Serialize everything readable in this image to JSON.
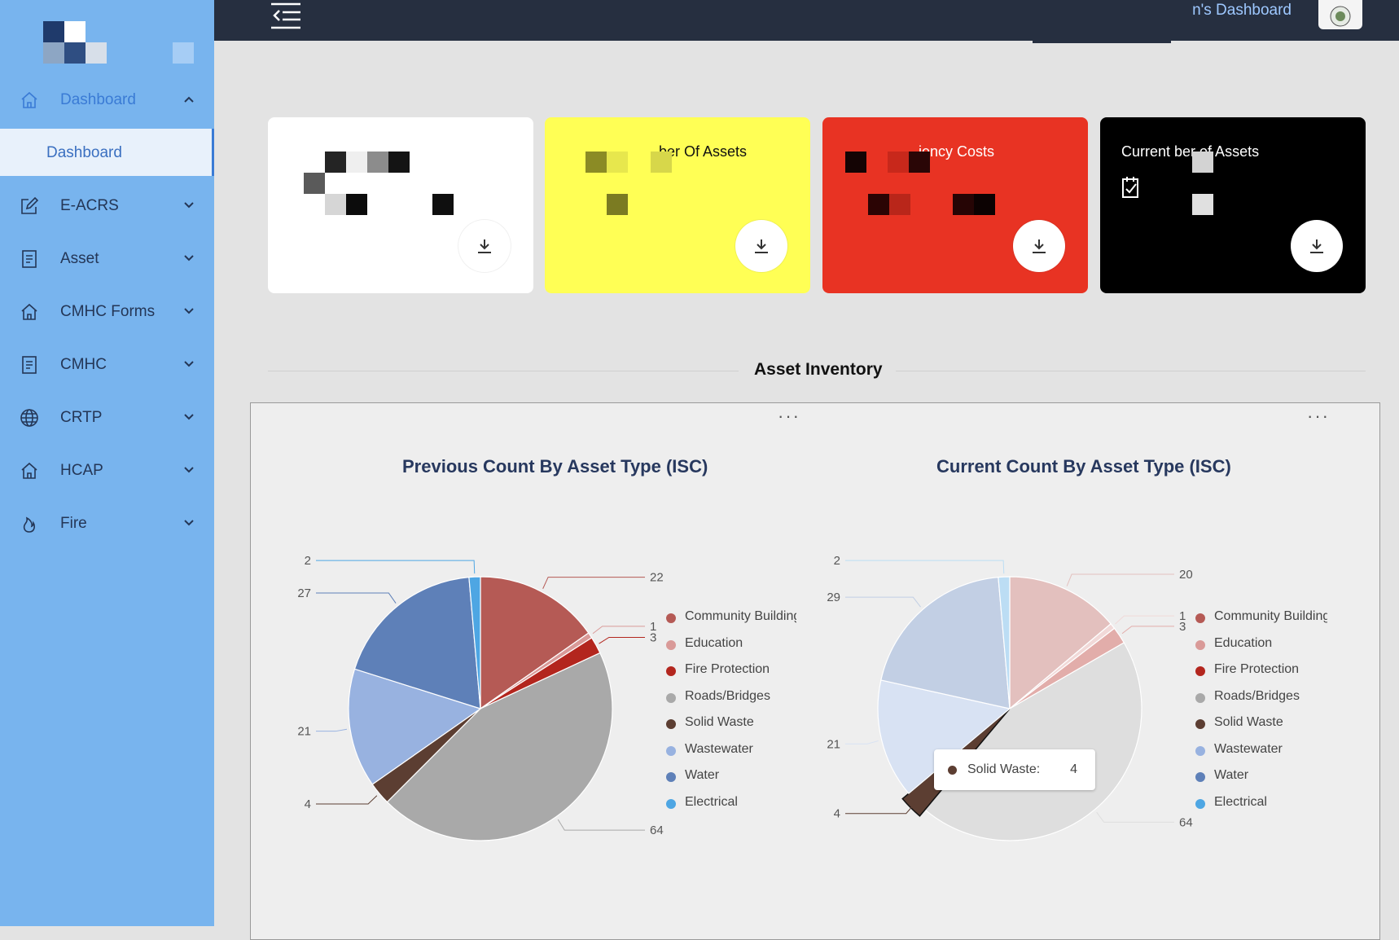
{
  "topbar": {
    "title": "n's Dashboard"
  },
  "sidebar": {
    "items": [
      {
        "label": "Dashboard",
        "icon": "home-icon",
        "expanded": true
      },
      {
        "label": "E-ACRS",
        "icon": "edit-icon"
      },
      {
        "label": "Asset",
        "icon": "receipt-icon"
      },
      {
        "label": "CMHC Forms",
        "icon": "home-icon"
      },
      {
        "label": "CMHC",
        "icon": "receipt-icon"
      },
      {
        "label": "CRTP",
        "icon": "globe-icon"
      },
      {
        "label": "HCAP",
        "icon": "home-icon"
      },
      {
        "label": "Fire",
        "icon": "flame-icon"
      }
    ],
    "sub_item": "Dashboard"
  },
  "cards": [
    {
      "title": "",
      "bg": "#ffffff",
      "fg": "#111111"
    },
    {
      "title": "ber Of Assets",
      "bg": "#ffff55",
      "fg": "#111111"
    },
    {
      "title": "iency Costs",
      "bg": "#e83323",
      "fg": "#ffffff"
    },
    {
      "title": "Current  ber of Assets",
      "bg": "#000000",
      "fg": "#ffffff"
    }
  ],
  "section": {
    "title": "Asset Inventory"
  },
  "colors": {
    "Community Building": "#b55a55",
    "Education": "#d99a98",
    "Fire Protection": "#b3261e",
    "Roads/Bridges": "#a9a9a9",
    "Solid Waste": "#5c3e32",
    "Wastewater": "#98b2e0",
    "Water": "#5e80b8",
    "Electrical": "#4ea6e3"
  },
  "chart_data": [
    {
      "type": "pie",
      "title": "Previous Count By Asset Type (ISC)",
      "categories": [
        "Community Building",
        "Education",
        "Fire Protection",
        "Roads/Bridges",
        "Solid Waste",
        "Wastewater",
        "Water",
        "Electrical"
      ],
      "values": [
        22,
        1,
        3,
        64,
        4,
        21,
        27,
        2
      ],
      "legend": [
        "Community Building",
        "Education",
        "Fire Protection",
        "Roads/Bridges",
        "Solid Waste",
        "Wastewater",
        "Water",
        "Electrical"
      ],
      "legend_position": "right"
    },
    {
      "type": "pie",
      "title": "Current Count By Asset Type (ISC)",
      "categories": [
        "Community Building",
        "Education",
        "Fire Protection",
        "Roads/Bridges",
        "Solid Waste",
        "Wastewater",
        "Water",
        "Electrical"
      ],
      "values": [
        20,
        1,
        3,
        64,
        4,
        21,
        29,
        2
      ],
      "legend": [
        "Community Building",
        "Education",
        "Fire Protection",
        "Roads/Bridges",
        "Solid Waste",
        "Wastewater",
        "Water",
        "Electrical"
      ],
      "legend_position": "right",
      "highlighted": "Solid Waste",
      "tooltip": {
        "label": "Solid Waste:",
        "value": "4"
      }
    }
  ]
}
